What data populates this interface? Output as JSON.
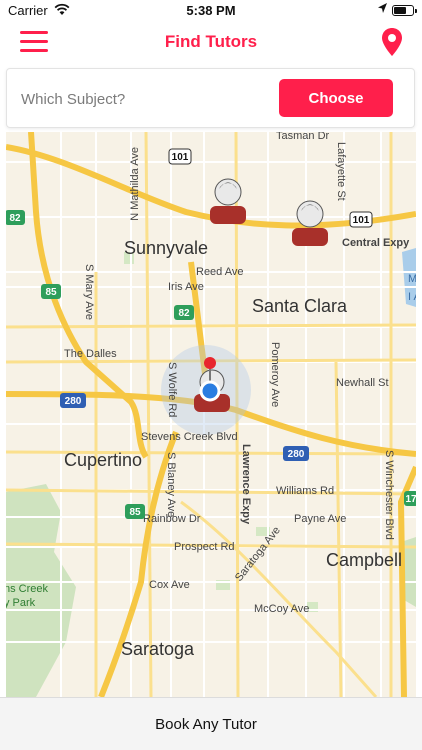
{
  "status": {
    "carrier": "Carrier",
    "time": "5:38 PM"
  },
  "header": {
    "title": "Find Tutors",
    "menu_icon": "hamburger-menu-icon",
    "location_icon": "map-pin-icon"
  },
  "search": {
    "placeholder": "Which Subject?",
    "value": "",
    "button_label": "Choose"
  },
  "map": {
    "cities": [
      "Sunnyvale",
      "Santa Clara",
      "Cupertino",
      "Campbell",
      "Saratoga"
    ],
    "streets": [
      "Tasman Dr",
      "Lafayette St",
      "N Mathilda Ave",
      "Central Expy",
      "Reed Ave",
      "Iris Ave",
      "S Mary Ave",
      "Pomeroy Ave",
      "Newhall St",
      "The Dalles",
      "S Wolfe Rd",
      "Stevens Creek Blvd",
      "S Blaney Ave",
      "Lawrence Expy",
      "Williams Rd",
      "S Winchester Blvd",
      "Payne Ave",
      "Rainbow Dr",
      "Prospect Rd",
      "Saratoga Ave",
      "Cox Ave",
      "McCoy Ave"
    ],
    "highways": [
      "101",
      "101",
      "82",
      "85",
      "82",
      "280",
      "280",
      "85",
      "17"
    ],
    "park_label_1": "ns Creek",
    "park_label_2": "y Park",
    "edge_label_1": "Min",
    "edge_label_2": "I Ar"
  },
  "footer": {
    "book_label": "Book Any Tutor"
  }
}
